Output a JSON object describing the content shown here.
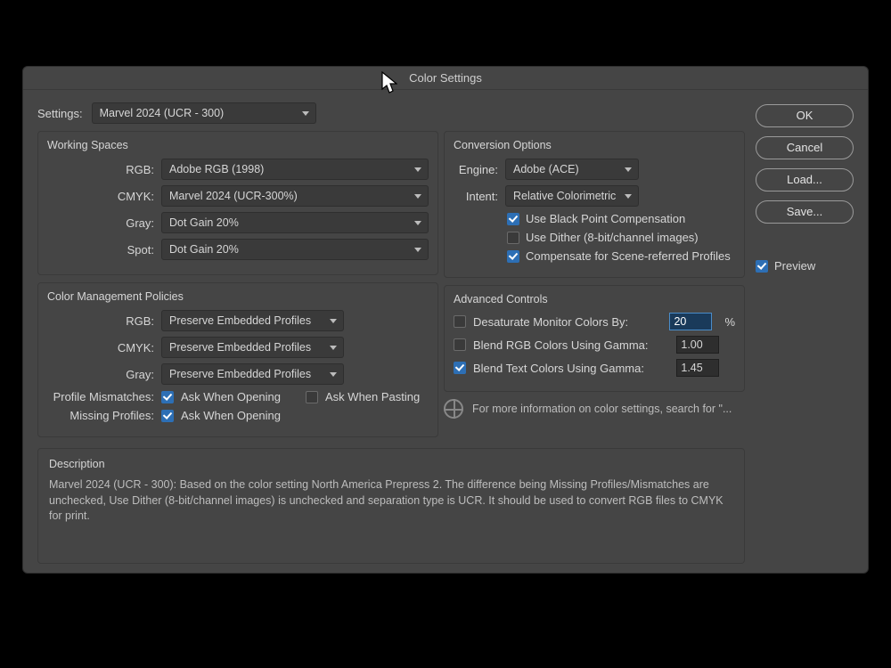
{
  "dialog": {
    "title": "Color Settings",
    "settings_label": "Settings:",
    "settings_value": "Marvel 2024 (UCR - 300)"
  },
  "working_spaces": {
    "title": "Working Spaces",
    "rgb_label": "RGB:",
    "rgb_value": "Adobe RGB (1998)",
    "cmyk_label": "CMYK:",
    "cmyk_value": "Marvel 2024 (UCR-300%)",
    "gray_label": "Gray:",
    "gray_value": "Dot Gain 20%",
    "spot_label": "Spot:",
    "spot_value": "Dot Gain 20%"
  },
  "policies": {
    "title": "Color Management Policies",
    "rgb_label": "RGB:",
    "rgb_value": "Preserve Embedded Profiles",
    "cmyk_label": "CMYK:",
    "cmyk_value": "Preserve Embedded Profiles",
    "gray_label": "Gray:",
    "gray_value": "Preserve Embedded Profiles",
    "mismatch_label": "Profile Mismatches:",
    "mismatch_open": "Ask When Opening",
    "mismatch_paste": "Ask When Pasting",
    "missing_label": "Missing Profiles:",
    "missing_open": "Ask When Opening"
  },
  "conversion": {
    "title": "Conversion Options",
    "engine_label": "Engine:",
    "engine_value": "Adobe (ACE)",
    "intent_label": "Intent:",
    "intent_value": "Relative Colorimetric",
    "bpc": "Use Black Point Compensation",
    "dither": "Use Dither (8-bit/channel images)",
    "scene": "Compensate for Scene-referred Profiles"
  },
  "advanced": {
    "title": "Advanced Controls",
    "desat_label": "Desaturate Monitor Colors By:",
    "desat_value": "20",
    "desat_unit": "%",
    "blend_rgb_label": "Blend RGB Colors Using Gamma:",
    "blend_rgb_value": "1.00",
    "blend_text_label": "Blend Text Colors Using Gamma:",
    "blend_text_value": "1.45"
  },
  "info": {
    "text": "For more information on color settings, search for \"..."
  },
  "description": {
    "title": "Description",
    "body": "Marvel 2024 (UCR - 300):  Based on the color setting North America Prepress 2. The difference being Missing Profiles/Mismatches are unchecked, Use Dither (8-bit/channel images) is unchecked and separation type is UCR. It should be used to convert RGB files to CMYK for print."
  },
  "buttons": {
    "ok": "OK",
    "cancel": "Cancel",
    "load": "Load...",
    "save": "Save..."
  },
  "preview_label": "Preview"
}
